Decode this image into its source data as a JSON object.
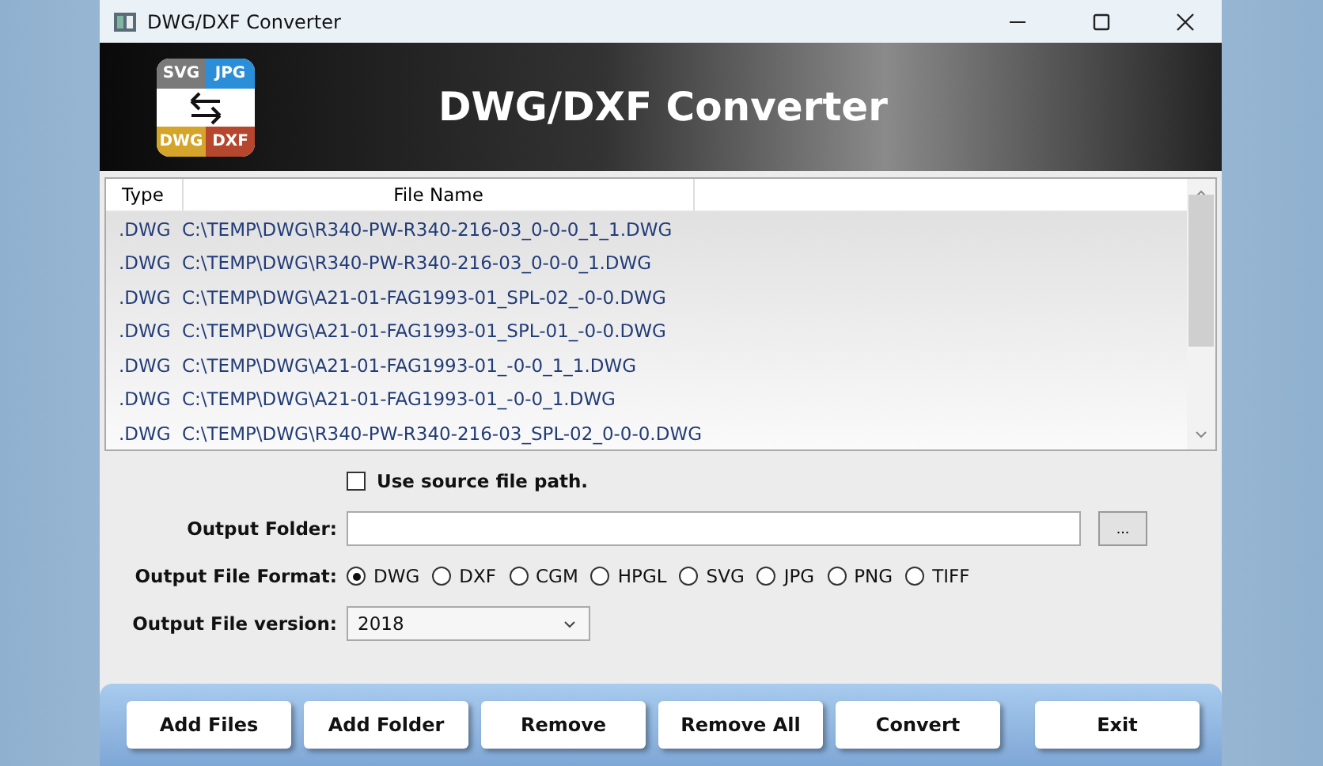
{
  "window": {
    "title": "DWG/DXF Converter"
  },
  "banner": {
    "logo_labels": [
      "SVG",
      "JPG",
      "DWG",
      "DXF"
    ],
    "title": "DWG/DXF Converter"
  },
  "table": {
    "columns": [
      "Type",
      "File Name"
    ],
    "rows": [
      {
        "type": ".DWG",
        "file": "C:\\TEMP\\DWG\\R340-PW-R340-216-03_0-0-0_1_1.DWG"
      },
      {
        "type": ".DWG",
        "file": "C:\\TEMP\\DWG\\R340-PW-R340-216-03_0-0-0_1.DWG"
      },
      {
        "type": ".DWG",
        "file": "C:\\TEMP\\DWG\\A21-01-FAG1993-01_SPL-02_-0-0.DWG"
      },
      {
        "type": ".DWG",
        "file": "C:\\TEMP\\DWG\\A21-01-FAG1993-01_SPL-01_-0-0.DWG"
      },
      {
        "type": ".DWG",
        "file": "C:\\TEMP\\DWG\\A21-01-FAG1993-01_-0-0_1_1.DWG"
      },
      {
        "type": ".DWG",
        "file": "C:\\TEMP\\DWG\\A21-01-FAG1993-01_-0-0_1.DWG"
      },
      {
        "type": ".DWG",
        "file": "C:\\TEMP\\DWG\\R340-PW-R340-216-03_SPL-02_0-0-0.DWG"
      }
    ]
  },
  "use_source_path": {
    "label": "Use source file path.",
    "checked": false
  },
  "output_folder": {
    "label": "Output Folder:",
    "browse": "..."
  },
  "output_format": {
    "label": "Output File Format:",
    "options": [
      {
        "label": "DWG",
        "selected": true
      },
      {
        "label": "DXF",
        "selected": false
      },
      {
        "label": "CGM",
        "selected": false
      },
      {
        "label": "HPGL",
        "selected": false
      },
      {
        "label": "SVG",
        "selected": false
      },
      {
        "label": "JPG",
        "selected": false
      },
      {
        "label": "PNG",
        "selected": false
      },
      {
        "label": "TIFF",
        "selected": false
      }
    ]
  },
  "output_version": {
    "label": "Output File version:",
    "value": "2018"
  },
  "buttons": [
    "Add Files",
    "Add Folder",
    "Remove",
    "Remove All",
    "Convert",
    "Exit"
  ]
}
